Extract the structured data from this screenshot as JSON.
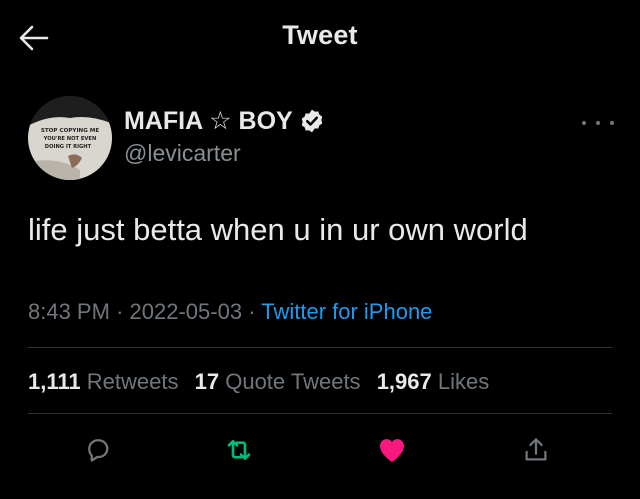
{
  "header": {
    "title": "Tweet",
    "back_icon": "arrow-left-icon"
  },
  "author": {
    "display_name": "MAFIA ☆ BOY",
    "handle": "@levicarter",
    "verified": true,
    "avatar_shirt_text": [
      "STOP COPYING ME",
      "YOU'RE NOT EVEN",
      "DOING IT RIGHT"
    ]
  },
  "tweet": {
    "text": "life just betta when u in ur own world",
    "time": "8:43 PM",
    "separator": "·",
    "date": "2022-05-03",
    "source": "Twitter for iPhone"
  },
  "stats": {
    "retweets_count": "1,111",
    "retweets_label": "Retweets",
    "quotes_count": "17",
    "quotes_label": "Quote Tweets",
    "likes_count": "1,967",
    "likes_label": "Likes"
  },
  "actions": {
    "reply_icon": "reply-icon",
    "retweet_icon": "retweet-icon",
    "like_icon": "heart-icon",
    "share_icon": "share-icon",
    "liked": true,
    "retweeted": true
  },
  "colors": {
    "background": "#000000",
    "text_primary": "#e7e9ea",
    "text_secondary": "#71767b",
    "link": "#1d9bf0",
    "retweet_green": "#00ba7c",
    "like_pink": "#f91880",
    "divider": "#2f3336"
  }
}
